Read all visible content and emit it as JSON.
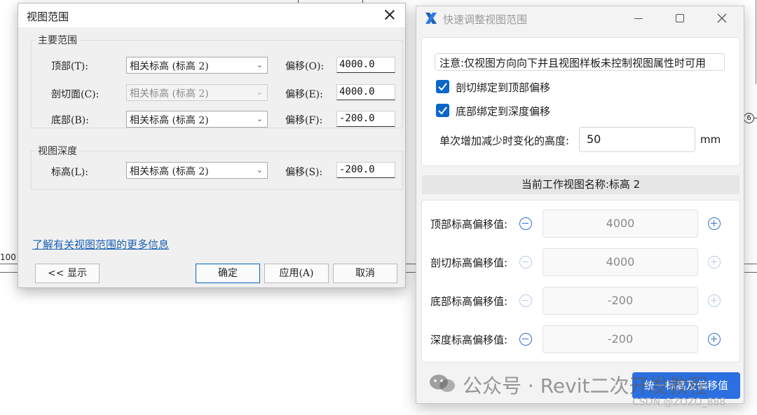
{
  "background": {
    "scale_label": "100",
    "grid_marker": "6"
  },
  "view_range_dialog": {
    "title": "视图范围",
    "primary_range_group": "主要范围",
    "top_label": "顶部(T):",
    "top_level": "相关标高 (标高 2)",
    "offset_o_label": "偏移(O):",
    "offset_o_value": "4000.0",
    "cut_label": "剖切面(C):",
    "cut_level": "相关标高 (标高 2)",
    "offset_e_label": "偏移(E):",
    "offset_e_value": "4000.0",
    "bottom_label": "底部(B):",
    "bottom_level": "相关标高 (标高 2)",
    "offset_f_label": "偏移(F):",
    "offset_f_value": "-200.0",
    "view_depth_group": "视图深度",
    "level_label": "标高(L):",
    "level_value": "相关标高 (标高 2)",
    "offset_s_label": "偏移(S):",
    "offset_s_value": "-200.0",
    "more_info_link": "了解有关视图范围的更多信息",
    "show_button": "<< 显示",
    "ok_button": "确定",
    "apply_button": "应用(A)",
    "cancel_button": "取消"
  },
  "quick_adjust_window": {
    "title": "快速调整视图范围",
    "note": "注意:仅视图方向向下并且视图样板未控制视图属性时可用",
    "bind_cut_label": "剖切绑定到顶部偏移",
    "bind_cut_checked": true,
    "bind_bottom_label": "底部绑定到深度偏移",
    "bind_bottom_checked": true,
    "step_label": "单次增加减少时变化的高度:",
    "step_value": "50",
    "step_unit": "mm",
    "current_view": "当前工作视图名称:标高 2",
    "rows": [
      {
        "label": "顶部标高偏移值:",
        "value": "4000"
      },
      {
        "label": "剖切标高偏移值:",
        "value": "4000"
      },
      {
        "label": "底部标高偏移值:",
        "value": "-200"
      },
      {
        "label": "深度标高偏移值:",
        "value": "-200"
      }
    ],
    "unify_button": "统一标高及偏移值"
  },
  "watermark": {
    "text": "公众号 · Revit二次开发教程",
    "credit": "CSDN @ZOZO_888"
  },
  "colors": {
    "accent": "#2b6fe0",
    "checkbox": "#0b67c8",
    "link": "#1a5fb4"
  }
}
